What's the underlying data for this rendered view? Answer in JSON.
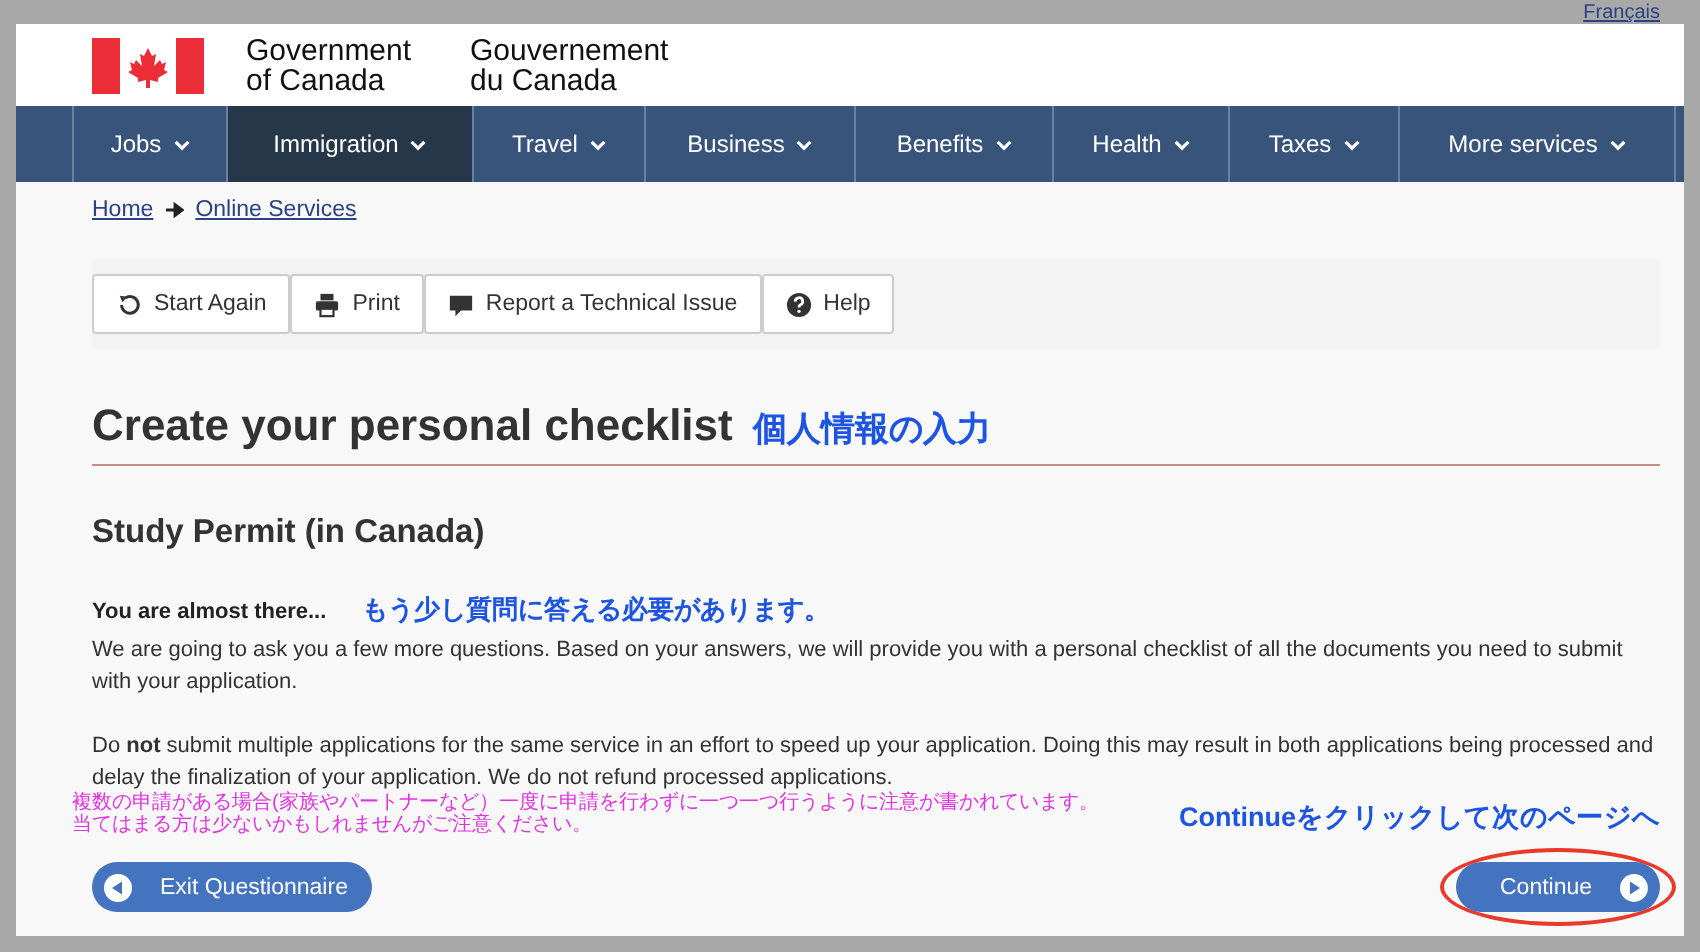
{
  "language_link": "Français",
  "header": {
    "title_en": [
      "Government",
      "of Canada"
    ],
    "title_fr": [
      "Gouvernement",
      "du Canada"
    ]
  },
  "nav": [
    {
      "label": "Jobs",
      "selected": false
    },
    {
      "label": "Immigration",
      "selected": true
    },
    {
      "label": "Travel",
      "selected": false
    },
    {
      "label": "Business",
      "selected": false
    },
    {
      "label": "Benefits",
      "selected": false
    },
    {
      "label": "Health",
      "selected": false
    },
    {
      "label": "Taxes",
      "selected": false
    },
    {
      "label": "More services",
      "selected": false
    }
  ],
  "breadcrumb": [
    "Home",
    "Online Services"
  ],
  "toolbar": [
    {
      "kind": "restart",
      "label": "Start Again"
    },
    {
      "kind": "print",
      "label": "Print"
    },
    {
      "kind": "comment",
      "label": "Report a Technical Issue"
    },
    {
      "kind": "help",
      "label": "Help"
    }
  ],
  "title": "Create your personal checklist",
  "title_note": "個人情報の入力",
  "subtitle": "Study Permit (in Canada)",
  "intro_heading": "You are almost there...",
  "intro_note": "もう少し質問に答える必要があります。",
  "paragraphs": [
    "We are going to ask you a few more questions. Based on your answers, we will provide you with a personal checklist of all the documents you need to submit with your application.",
    "Do **not** submit multiple applications for the same service in an effort to speed up your application.  Doing this may result in both applications being processed and delay the finalization of your application. We do not refund processed applications."
  ],
  "warning_note": [
    "複数の申請がある場合(家族やパートナーなど）一度に申請を行わずに一つ一つ行うように注意が書かれています。",
    "当てはまる方は少ないかもしれませんがご注意ください。"
  ],
  "continue_note": "Continueをクリックして次のページへ",
  "exit_button": "Exit Questionnaire",
  "continue_button": "Continue",
  "continue_highlighted": true
}
